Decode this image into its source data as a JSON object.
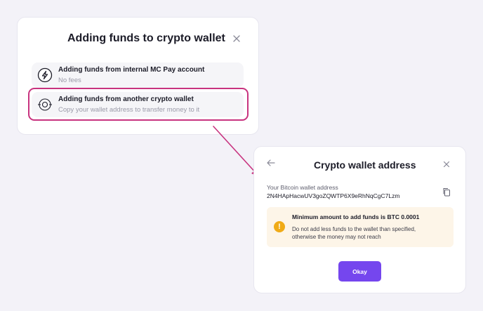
{
  "fund_dialog": {
    "title": "Adding funds to crypto wallet",
    "close_icon": "close-icon",
    "options": [
      {
        "icon": "lightning-icon",
        "title": "Adding funds from internal MC Pay account",
        "subtitle": "No fees"
      },
      {
        "icon": "target-icon",
        "title": "Adding funds from another crypto wallet",
        "subtitle": "Copy your wallet address to transfer money to it",
        "highlighted": true
      }
    ]
  },
  "address_dialog": {
    "title": "Crypto wallet address",
    "back_icon": "back-arrow-icon",
    "close_icon": "close-icon",
    "address_label": "Your Bitcoin wallet address",
    "address_value": "2N4HApHacwUV3goZQWTP6X9eRhNqCgC7Lzm",
    "copy_icon": "copy-icon",
    "warning": {
      "icon": "warning-icon",
      "symbol": "!",
      "title": "Minimum amount to add funds is BTC 0.0001",
      "line1": "Do not add less funds to the wallet than specified,",
      "line2": "otherwise the money may not reach"
    },
    "okay_label": "Okay"
  },
  "colors": {
    "highlight": "#c8337f",
    "primary_button": "#7546ee",
    "warning_bg": "#fdf5e8",
    "warning_icon": "#f0ab17"
  }
}
